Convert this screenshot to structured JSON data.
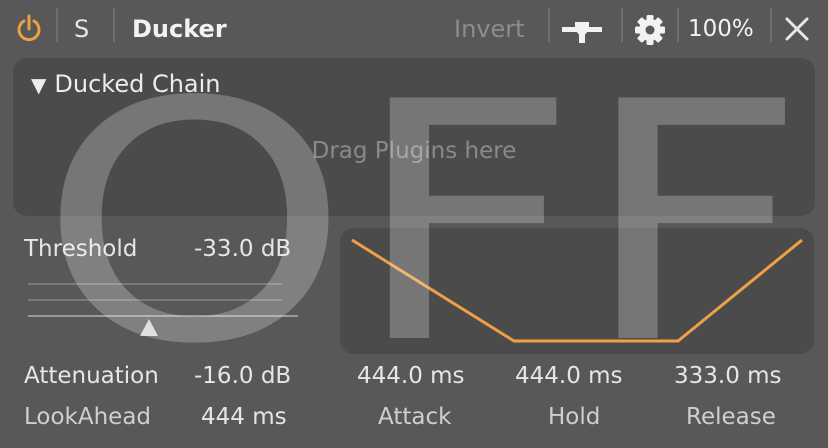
{
  "header": {
    "solo_label": "S",
    "title": "Ducker",
    "invert_label": "Invert",
    "zoom": "100%",
    "icons": {
      "power": "power-icon",
      "routing": "routing-icon",
      "settings": "gear-icon",
      "close": "close-icon"
    }
  },
  "chain": {
    "toggle": "▼",
    "title": "Ducked Chain",
    "hint": "Drag Plugins here"
  },
  "params": {
    "threshold_label": "Threshold",
    "threshold_value": "-33.0 dB",
    "attenuation_label": "Attenuation",
    "attenuation_value": "-16.0 dB",
    "lookahead_label": "LookAhead",
    "lookahead_value": "444 ms"
  },
  "envelope": {
    "attack_value": "444.0 ms",
    "attack_label": "Attack",
    "hold_value": "444.0 ms",
    "hold_label": "Hold",
    "release_value": "333.0 ms",
    "release_label": "Release"
  },
  "overlay_text": "OFF",
  "colors": {
    "accent": "#f0a044",
    "background": "#585858",
    "panel": "#4b4b4b"
  }
}
